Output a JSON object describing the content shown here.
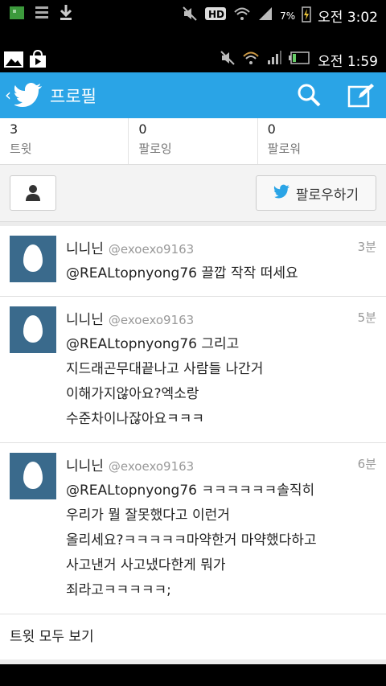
{
  "status_outer": {
    "battery_pct": "7%",
    "am_pm": "오전",
    "time": "3:02"
  },
  "status_inner": {
    "am_pm": "오전",
    "time": "1:59"
  },
  "header": {
    "title": "프로필"
  },
  "stats": [
    {
      "count": "3",
      "label": "트윗"
    },
    {
      "count": "0",
      "label": "팔로잉"
    },
    {
      "count": "0",
      "label": "팔로워"
    }
  ],
  "actions": {
    "follow_label": "팔로우하기"
  },
  "tweets": [
    {
      "name": "니니닌",
      "handle": "@exoexo9163",
      "time": "3분",
      "text": "@REALtopnyong76 끌깝 작작 떠세요"
    },
    {
      "name": "니니닌",
      "handle": "@exoexo9163",
      "time": "5분",
      "text": "@REALtopnyong76 그리고\n지드래곤무대끝나고 사람들 나간거\n이해가지않아요?엑소랑\n수준차이나잖아요ㅋㅋㅋ"
    },
    {
      "name": "니니닌",
      "handle": "@exoexo9163",
      "time": "6분",
      "text": "@REALtopnyong76 ㅋㅋㅋㅋㅋㅋ솔직히\n우리가 뭘 잘못했다고 이런거\n올리세요?ㅋㅋㅋㅋㅋ마약한거 마약했다하고\n사고낸거 사고냈다한게 뭐가\n죄라고ㅋㅋㅋㅋㅋ;"
    }
  ],
  "see_all": "트윗 모두 보기",
  "colors": {
    "accent": "#2aa4e6",
    "avatar_bg": "#3a6a8c"
  }
}
